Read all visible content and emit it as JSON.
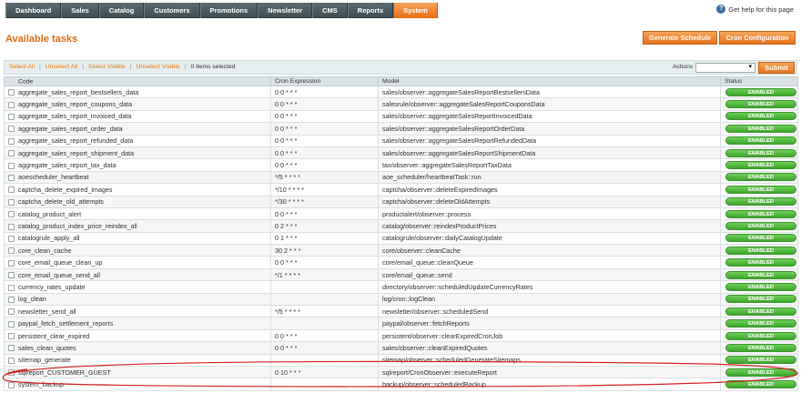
{
  "nav": {
    "items": [
      "Dashboard",
      "Sales",
      "Catalog",
      "Customers",
      "Promotions",
      "Newsletter",
      "CMS",
      "Reports",
      "System"
    ],
    "active": "System",
    "help_label": "Get help for this page"
  },
  "page": {
    "title": "Available tasks",
    "generate_schedule_label": "Generate Schedule",
    "cron_config_label": "Cron Configuration"
  },
  "massaction": {
    "select_all": "Select All",
    "unselect_all": "Unselect All",
    "select_visible": "Select Visible",
    "unselect_visible": "Unselect Visible",
    "selected_count": "0 items selected",
    "actions_label": "Actions",
    "actions_value": "",
    "submit_label": "Submit"
  },
  "table": {
    "columns": [
      "Code",
      "Cron Expression",
      "Model",
      "Status"
    ],
    "rows": [
      {
        "code": "aggregate_sales_report_bestsellers_data",
        "cron": "0 0 * * *",
        "model": "sales/observer::aggregateSalesReportBestsellersData",
        "status": "ENABLED"
      },
      {
        "code": "aggregate_sales_report_coupons_data",
        "cron": "0 0 * * *",
        "model": "salesrule/observer::aggregateSalesReportCouponsData",
        "status": "ENABLED"
      },
      {
        "code": "aggregate_sales_report_invoiced_data",
        "cron": "0 0 * * *",
        "model": "sales/observer::aggregateSalesReportInvoicedData",
        "status": "ENABLED"
      },
      {
        "code": "aggregate_sales_report_order_data",
        "cron": "0 0 * * *",
        "model": "sales/observer::aggregateSalesReportOrderData",
        "status": "ENABLED"
      },
      {
        "code": "aggregate_sales_report_refunded_data",
        "cron": "0 0 * * *",
        "model": "sales/observer::aggregateSalesReportRefundedData",
        "status": "ENABLED"
      },
      {
        "code": "aggregate_sales_report_shipment_data",
        "cron": "0 0 * * *",
        "model": "sales/observer::aggregateSalesReportShipmentData",
        "status": "ENABLED"
      },
      {
        "code": "aggregate_sales_report_tax_data",
        "cron": "0 0 * * *",
        "model": "tax/observer::aggregateSalesReportTaxData",
        "status": "ENABLED"
      },
      {
        "code": "aoescheduler_heartbeat",
        "cron": "*/5 * * * *",
        "model": "aoe_scheduler/heartbeatTask::run",
        "status": "ENABLED"
      },
      {
        "code": "captcha_delete_expired_images",
        "cron": "*/10 * * * *",
        "model": "captcha/observer::deleteExpiredImages",
        "status": "ENABLED"
      },
      {
        "code": "captcha_delete_old_attempts",
        "cron": "*/30 * * * *",
        "model": "captcha/observer::deleteOldAttempts",
        "status": "ENABLED"
      },
      {
        "code": "catalog_product_alert",
        "cron": "0 0 * * *",
        "model": "productalert/observer::process",
        "status": "ENABLED"
      },
      {
        "code": "catalog_product_index_price_reindex_all",
        "cron": "0 2 * * *",
        "model": "catalog/observer::reindexProductPrices",
        "status": "ENABLED"
      },
      {
        "code": "catalogrule_apply_all",
        "cron": "0 1 * * *",
        "model": "catalogrule/observer::dailyCatalogUpdate",
        "status": "ENABLED"
      },
      {
        "code": "core_clean_cache",
        "cron": "30 2 * * *",
        "model": "core/observer::cleanCache",
        "status": "ENABLED"
      },
      {
        "code": "core_email_queue_clean_up",
        "cron": "0 0 * * *",
        "model": "core/email_queue::cleanQueue",
        "status": "ENABLED"
      },
      {
        "code": "core_email_queue_send_all",
        "cron": "*/1 * * * *",
        "model": "core/email_queue::send",
        "status": "ENABLED"
      },
      {
        "code": "currency_rates_update",
        "cron": "",
        "model": "directory/observer::scheduledUpdateCurrencyRates",
        "status": "ENABLED"
      },
      {
        "code": "log_clean",
        "cron": "",
        "model": "log/cron::logClean",
        "status": "ENABLED"
      },
      {
        "code": "newsletter_send_all",
        "cron": "*/5 * * * *",
        "model": "newsletter/observer::scheduledSend",
        "status": "ENABLED"
      },
      {
        "code": "paypal_fetch_settlement_reports",
        "cron": "",
        "model": "paypal/observer::fetchReports",
        "status": "ENABLED"
      },
      {
        "code": "persistent_clear_expired",
        "cron": "0 0 * * *",
        "model": "persistent/observer::clearExpiredCronJob",
        "status": "ENABLED"
      },
      {
        "code": "sales_clean_quotes",
        "cron": "0 0 * * *",
        "model": "sales/observer::cleanExpiredQuotes",
        "status": "ENABLED"
      },
      {
        "code": "sitemap_generate",
        "cron": "",
        "model": "sitemap/observer::scheduledGenerateSitemaps",
        "status": "ENABLED"
      },
      {
        "code": "sqlreport_CUSTOMER_GUEST",
        "cron": "0 10 * * *",
        "model": "sqlreport/CronObserver::executeReport",
        "status": "ENABLED"
      },
      {
        "code": "system_backup",
        "cron": "",
        "model": "backup/observer::scheduledBackup",
        "status": "ENABLED"
      }
    ]
  },
  "colors": {
    "accent": "#e36b12",
    "nav_bg": "#4a5b60",
    "status_enabled": "#3da52c",
    "annotation": "#d21f1f"
  }
}
